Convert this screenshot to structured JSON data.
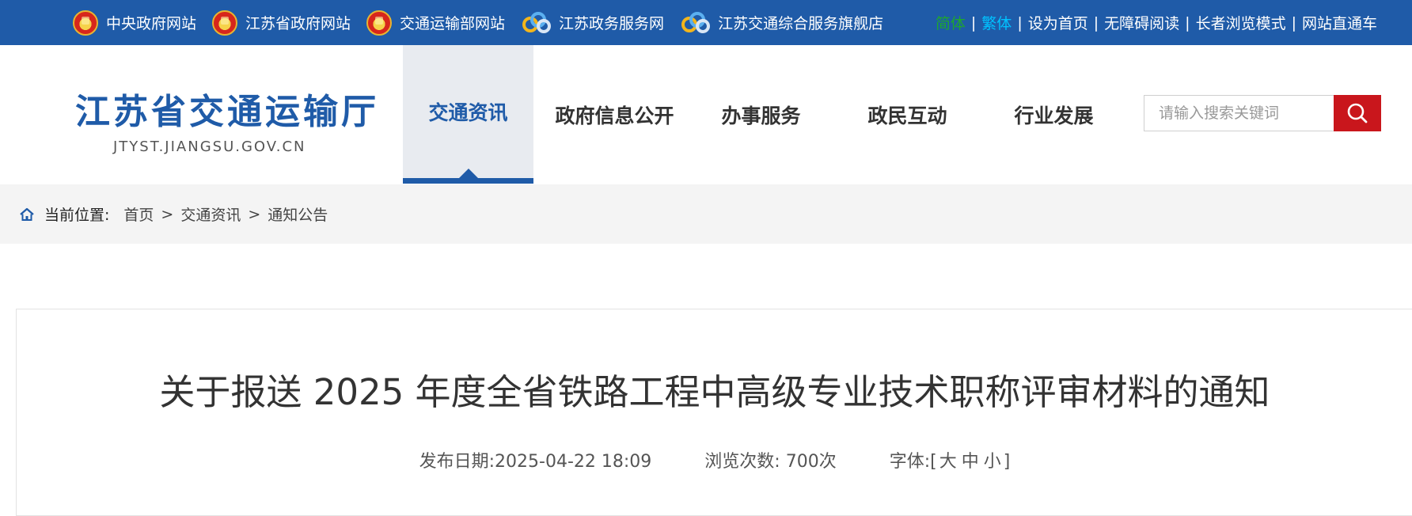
{
  "topbar": {
    "links": [
      {
        "label": "中央政府网站",
        "icon": "national-emblem-icon"
      },
      {
        "label": "江苏省政府网站",
        "icon": "national-emblem-icon"
      },
      {
        "label": "交通运输部网站",
        "icon": "national-emblem-icon"
      },
      {
        "label": "江苏政务服务网",
        "icon": "service-ring-icon"
      },
      {
        "label": "江苏交通综合服务旗舰店",
        "icon": "service-ring-icon"
      }
    ],
    "right": {
      "simplified": "简体",
      "traditional": "繁体",
      "sep": "|",
      "set_home": "设为首页",
      "accessible": "无障碍阅读",
      "elder_mode": "长者浏览模式",
      "site_express": "网站直通车"
    }
  },
  "logo": {
    "name": "江苏省交通运输厅",
    "domain": "JTYST.JIANGSU.GOV.CN"
  },
  "nav": {
    "items": [
      {
        "label": "交通资讯",
        "active": true
      },
      {
        "label": "政府信息公开",
        "active": false
      },
      {
        "label": "办事服务",
        "active": false
      },
      {
        "label": "政民互动",
        "active": false
      },
      {
        "label": "行业发展",
        "active": false
      }
    ]
  },
  "search": {
    "placeholder": "请输入搜索关键词",
    "icon": "search-icon"
  },
  "breadcrumb": {
    "label": "当前位置:",
    "items": [
      "首页",
      "交通资讯",
      "通知公告"
    ],
    "sep": ">"
  },
  "article": {
    "title": "关于报送 2025 年度全省铁路工程中高级专业技术职称评审材料的通知",
    "date_label": "发布日期:",
    "date": "2025-04-22 18:09",
    "views_label": "浏览次数:",
    "views": "700次",
    "font_label": "字体:",
    "font_open": "[",
    "font_large": "大",
    "font_medium": "中",
    "font_small": "小",
    "font_close": "]"
  },
  "colors": {
    "brand_blue": "#1f5ba8",
    "search_red": "#c9161c",
    "simplified_green": "#1ea62f",
    "traditional_cyan": "#00c2ff"
  }
}
